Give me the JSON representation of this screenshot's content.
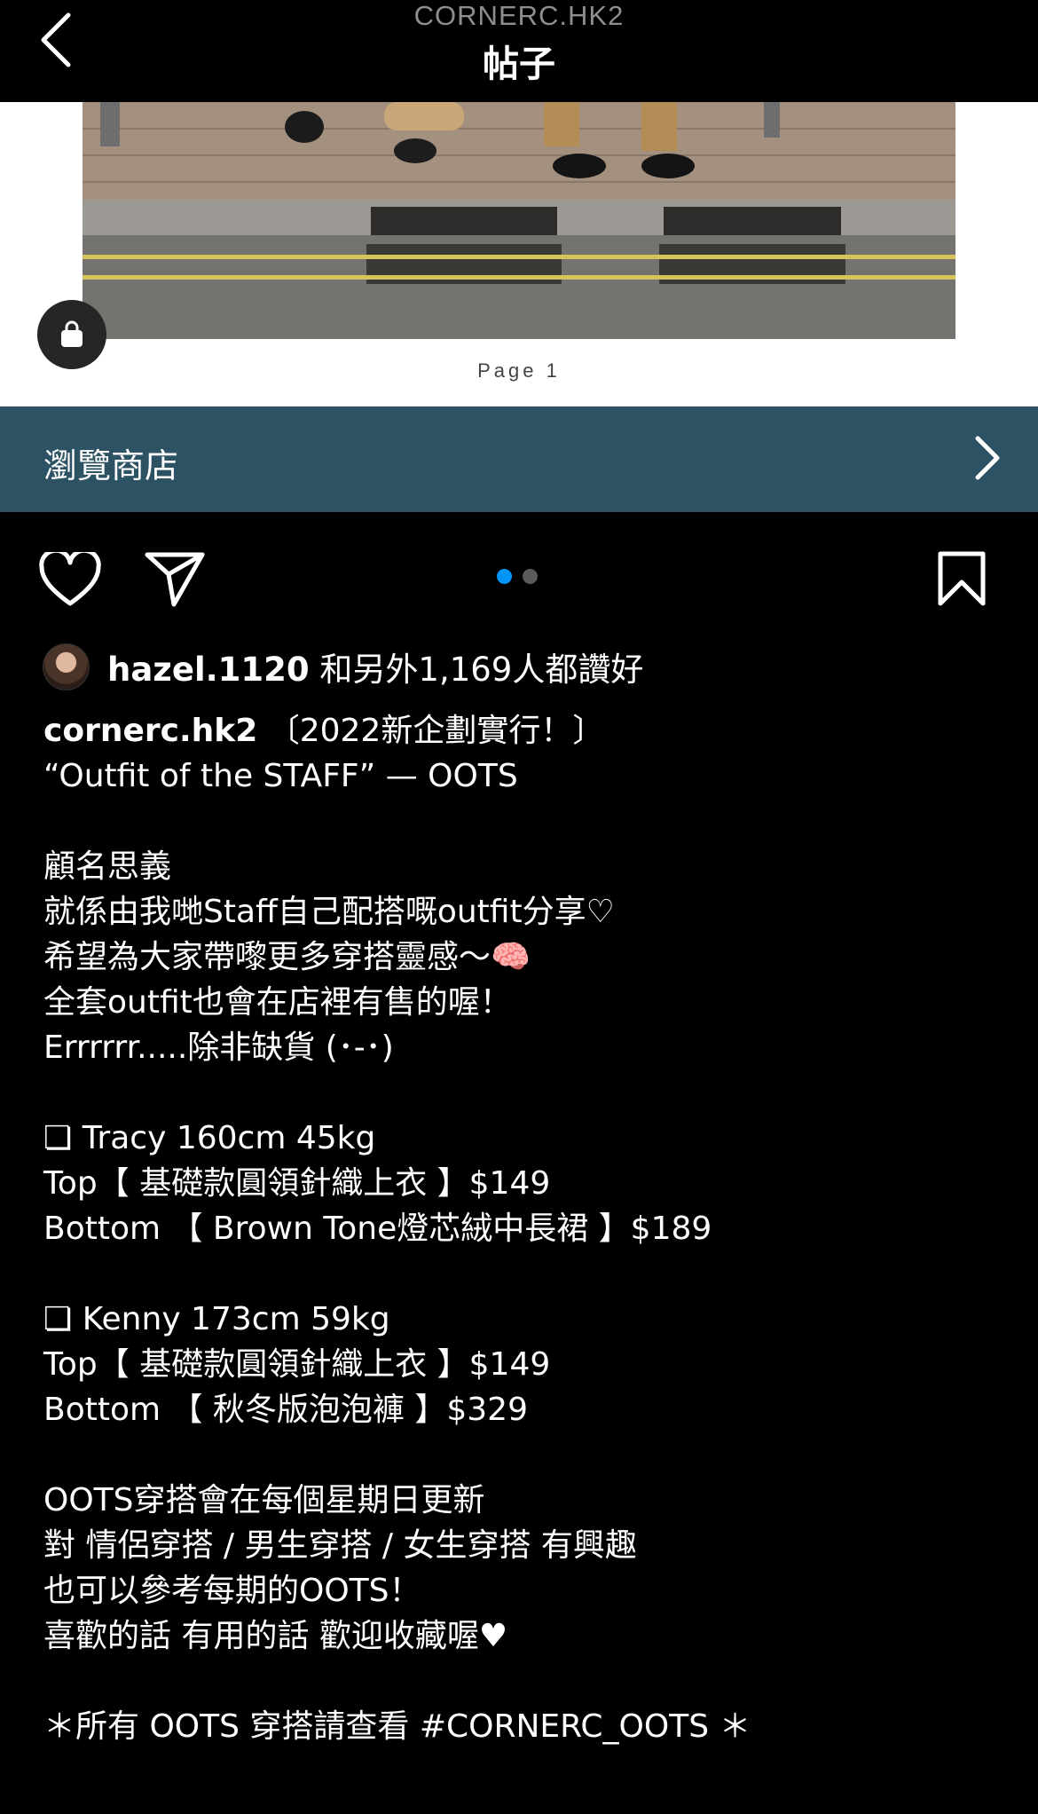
{
  "header": {
    "subtitle": "CORNERC.HK2",
    "title": "帖子"
  },
  "post": {
    "page_caption": "Page 1",
    "shop_banner_label": "瀏覽商店",
    "carousel": {
      "count": 2,
      "active": 1
    },
    "likes": {
      "user": "hazel.1120",
      "text": "和另外1,169人都讚好"
    },
    "caption": {
      "username": "cornerc.hk2",
      "lines": [
        "〔2022新企劃實行！〕",
        "“Outfit of the STAFF” — OOTS",
        "",
        "顧名思義",
        "就係由我哋Staff自己配搭嘅outfit分享♡",
        "希望為大家帶嚟更多穿搭靈感～🧠",
        "全套outfit也會在店裡有售的喔！",
        "Errrrrr.....除非缺貨 (･-･)",
        "",
        "❏ Tracy 160cm 45kg",
        "Top【 基礎款圓領針織上衣 】$149",
        "Bottom 【 Brown Tone燈芯絨中長裙 】$189",
        "",
        "❏ Kenny 173cm 59kg",
        "Top【 基礎款圓領針織上衣 】$149",
        "Bottom 【 秋冬版泡泡褲 】$329",
        "",
        "OOTS穿搭會在每個星期日更新",
        "對 情侶穿搭 / 男生穿搭 / 女生穿搭 有興趣",
        "也可以參考每期的OOTS！",
        "喜歡的話 有用的話 歡迎收藏喔♥",
        "",
        "＊所有 OOTS 穿搭請查看 #CORNERC_OOTS ＊"
      ]
    }
  },
  "colors": {
    "background": "#000000",
    "shop_banner": "#2c5264",
    "carousel_active": "#0095f6",
    "carousel_inactive": "#5a5a5a"
  },
  "icons": [
    "back-chevron-icon",
    "shopping-bag-icon",
    "chevron-right-icon",
    "heart-icon",
    "send-icon",
    "bookmark-icon"
  ]
}
